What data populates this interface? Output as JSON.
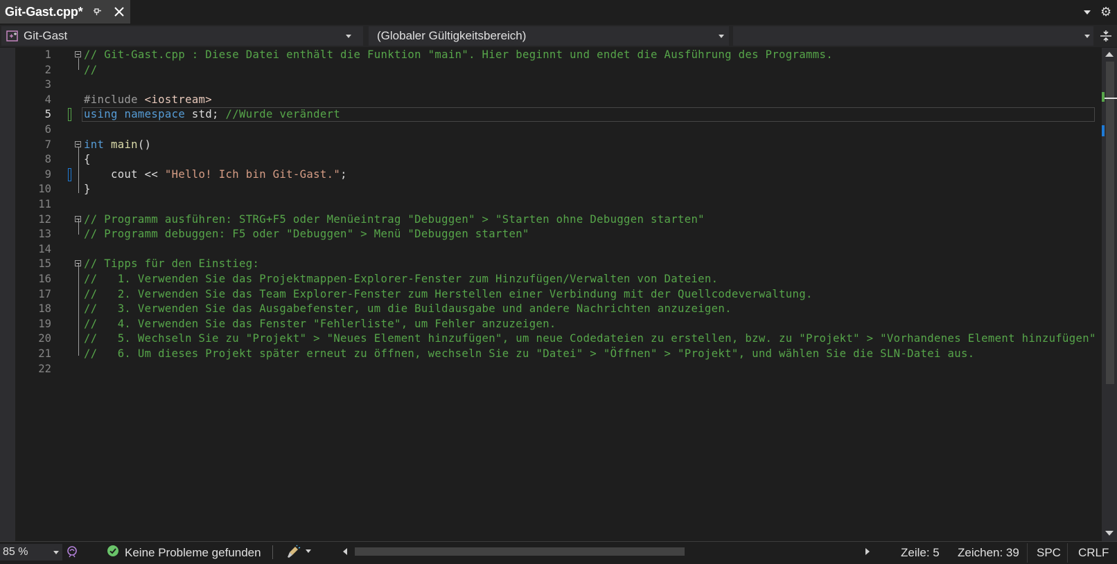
{
  "tab": {
    "title": "Git-Gast.cpp*"
  },
  "navbar": {
    "project": "Git-Gast",
    "scope": "(Globaler Gültigkeitsbereich)",
    "member": ""
  },
  "editor": {
    "current_line": 5,
    "lines": [
      {
        "n": "1",
        "tokens": [
          {
            "t": "// Git-Gast.cpp : Diese Datei enthält die Funktion \"main\". Hier beginnt und endet die Ausführung des Programms.",
            "c": "comment"
          }
        ]
      },
      {
        "n": "2",
        "tokens": [
          {
            "t": "//",
            "c": "comment"
          }
        ]
      },
      {
        "n": "3",
        "tokens": []
      },
      {
        "n": "4",
        "tokens": [
          {
            "t": "#include ",
            "c": "pre"
          },
          {
            "t": "<iostream>",
            "c": "inc"
          }
        ]
      },
      {
        "n": "5",
        "tokens": [
          {
            "t": "using",
            "c": "kw"
          },
          {
            "t": " ",
            "c": "txt"
          },
          {
            "t": "namespace",
            "c": "kw"
          },
          {
            "t": " std; ",
            "c": "txt"
          },
          {
            "t": "//Wurde verändert",
            "c": "comment"
          }
        ]
      },
      {
        "n": "6",
        "tokens": []
      },
      {
        "n": "7",
        "tokens": [
          {
            "t": "int",
            "c": "kw"
          },
          {
            "t": " ",
            "c": "txt"
          },
          {
            "t": "main",
            "c": "fn"
          },
          {
            "t": "()",
            "c": "txt"
          }
        ]
      },
      {
        "n": "8",
        "tokens": [
          {
            "t": "{",
            "c": "txt"
          }
        ]
      },
      {
        "n": "9",
        "tokens": [
          {
            "t": "    cout << ",
            "c": "txt"
          },
          {
            "t": "\"Hello! Ich bin Git-Gast.\"",
            "c": "str"
          },
          {
            "t": ";",
            "c": "txt"
          }
        ]
      },
      {
        "n": "10",
        "tokens": [
          {
            "t": "}",
            "c": "txt"
          }
        ]
      },
      {
        "n": "11",
        "tokens": []
      },
      {
        "n": "12",
        "tokens": [
          {
            "t": "// Programm ausführen: STRG+F5 oder Menüeintrag \"Debuggen\" > \"Starten ohne Debuggen starten\"",
            "c": "comment"
          }
        ]
      },
      {
        "n": "13",
        "tokens": [
          {
            "t": "// Programm debuggen: F5 oder \"Debuggen\" > Menü \"Debuggen starten\"",
            "c": "comment"
          }
        ]
      },
      {
        "n": "14",
        "tokens": []
      },
      {
        "n": "15",
        "tokens": [
          {
            "t": "// Tipps für den Einstieg:",
            "c": "comment"
          }
        ]
      },
      {
        "n": "16",
        "tokens": [
          {
            "t": "//   1. Verwenden Sie das Projektmappen-Explorer-Fenster zum Hinzufügen/Verwalten von Dateien.",
            "c": "comment"
          }
        ]
      },
      {
        "n": "17",
        "tokens": [
          {
            "t": "//   2. Verwenden Sie das Team Explorer-Fenster zum Herstellen einer Verbindung mit der Quellcodeverwaltung.",
            "c": "comment"
          }
        ]
      },
      {
        "n": "18",
        "tokens": [
          {
            "t": "//   3. Verwenden Sie das Ausgabefenster, um die Buildausgabe und andere Nachrichten anzuzeigen.",
            "c": "comment"
          }
        ]
      },
      {
        "n": "19",
        "tokens": [
          {
            "t": "//   4. Verwenden Sie das Fenster \"Fehlerliste\", um Fehler anzuzeigen.",
            "c": "comment"
          }
        ]
      },
      {
        "n": "20",
        "tokens": [
          {
            "t": "//   5. Wechseln Sie zu \"Projekt\" > \"Neues Element hinzufügen\", um neue Codedateien zu erstellen, bzw. zu \"Projekt\" > \"Vorhandenes Element hinzufügen\"",
            "c": "comment"
          }
        ]
      },
      {
        "n": "21",
        "tokens": [
          {
            "t": "//   6. Um dieses Projekt später erneut zu öffnen, wechseln Sie zu \"Datei\" > \"Öffnen\" > \"Projekt\", und wählen Sie die SLN-Datei aus.",
            "c": "comment"
          }
        ]
      },
      {
        "n": "22",
        "tokens": []
      }
    ]
  },
  "statusbar": {
    "zoom": "85 %",
    "problems": "Keine Probleme gefunden",
    "line": "Zeile: 5",
    "column": "Zeichen: 39",
    "whitespace": "SPC",
    "line_ending": "CRLF"
  },
  "colors": {
    "comment": "#57a64a",
    "keyword": "#569cd6",
    "string": "#d69d85",
    "function": "#dcdcaa",
    "background": "#1e1e1e",
    "change_saved": "#57a64a",
    "change_unsaved": "#1e7ad6"
  },
  "icons": {
    "tab_pin": "pin-icon",
    "tab_close": "close-icon",
    "settings": "gear-icon",
    "project": "cpp-project-icon",
    "split": "split-window-icon",
    "status_ok": "check-circle-icon",
    "intellicode": "intellicode-icon",
    "cleanup": "code-cleanup-brush-icon"
  }
}
